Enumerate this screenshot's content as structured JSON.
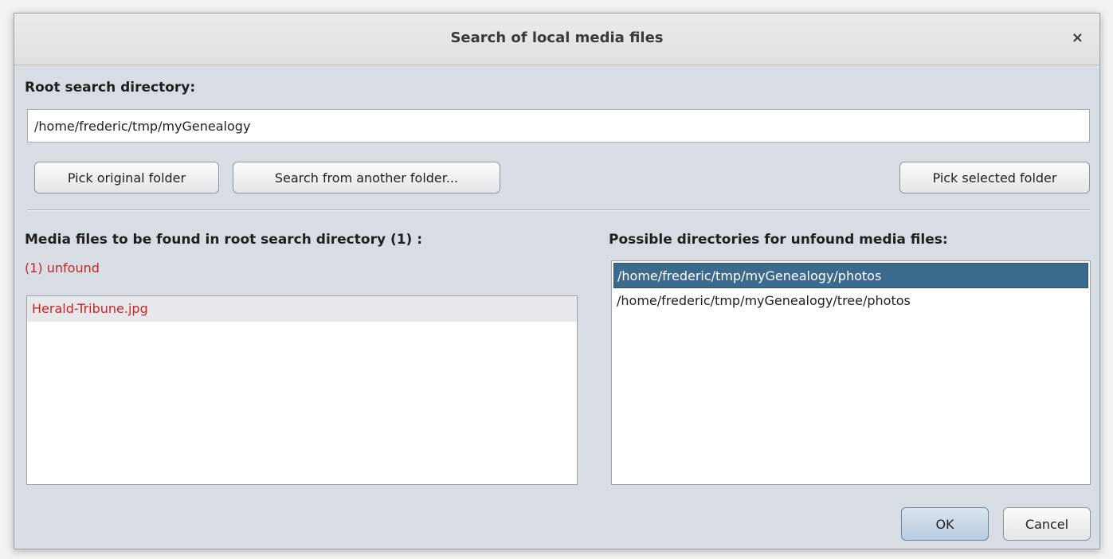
{
  "dialog": {
    "title": "Search of local media files",
    "close_symbol": "×"
  },
  "root_search": {
    "label": "Root search directory:",
    "value": "/home/frederic/tmp/myGenealogy",
    "placeholder": ""
  },
  "buttons": {
    "pick_original": "Pick original folder",
    "search_another": "Search from another folder...",
    "pick_selected": "Pick selected folder",
    "ok": "OK",
    "cancel": "Cancel"
  },
  "media_panel": {
    "heading": "Media files to be found in root search directory (1) :",
    "status": "(1) unfound",
    "items": [
      "Herald-Tribune.jpg"
    ]
  },
  "directories_panel": {
    "heading": "Possible directories for unfound media files:",
    "items": [
      "/home/frederic/tmp/myGenealogy/photos",
      "/home/frederic/tmp/myGenealogy/tree/photos"
    ],
    "selected_index": 0
  },
  "colors": {
    "unfound_text": "#c0262a",
    "selection": "#3c6a8c",
    "dialog_background": "#d8dde4"
  },
  "icons": {
    "close": "close-icon"
  }
}
